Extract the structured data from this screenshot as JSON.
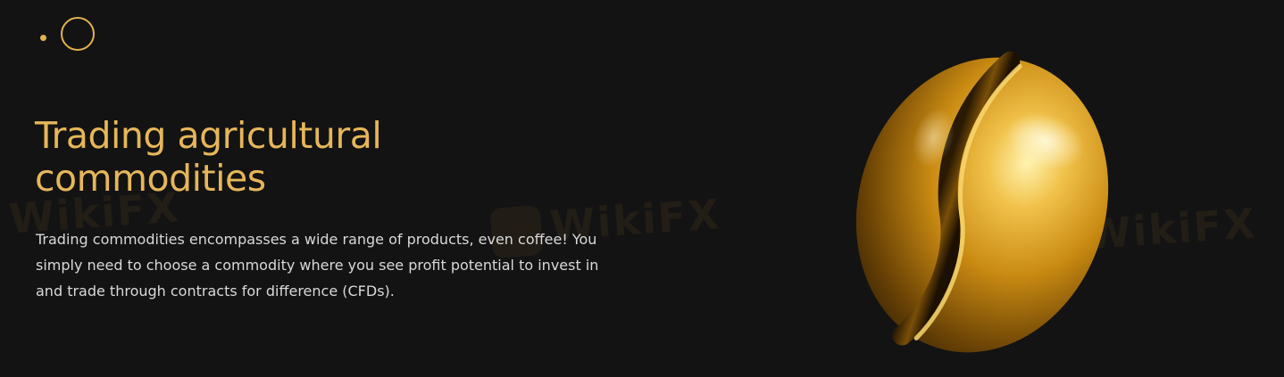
{
  "hero": {
    "title_line1": "Trading agricultural",
    "title_line2": "commodities",
    "description_line1": "Trading commodities encompasses a wide range of products, even coffee! You",
    "description_line2": "simply need to choose a commodity where you see profit potential to invest in",
    "description_line3": "and trade through contracts for difference (CFDs).",
    "image": "golden-coffee-bean",
    "accent_color": "#e6b659",
    "background_color": "#131313"
  },
  "decorations": {
    "dot": "small-gold-dot",
    "ring": "gold-ring-outline"
  },
  "watermarks": [
    {
      "text": "WikiFX"
    },
    {
      "text": "WikiFX"
    },
    {
      "text": "WikiFX"
    }
  ]
}
